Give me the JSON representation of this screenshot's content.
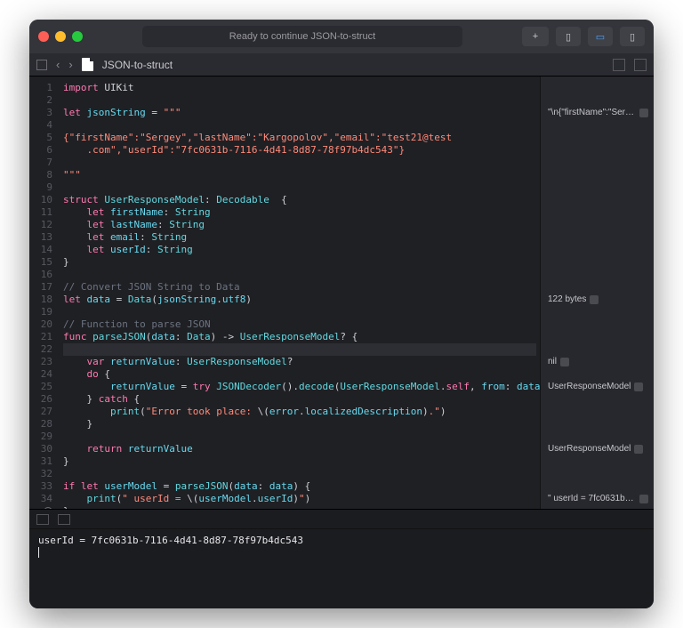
{
  "titlebar": {
    "status": "Ready to continue JSON-to-struct"
  },
  "tabbar": {
    "filename": "JSON-to-struct"
  },
  "code": {
    "lines": [
      {
        "n": 1,
        "segs": [
          {
            "c": "kw",
            "t": "import"
          },
          {
            "c": "",
            "t": " UIKit"
          }
        ]
      },
      {
        "n": 2,
        "segs": []
      },
      {
        "n": 3,
        "segs": [
          {
            "c": "kw",
            "t": "let"
          },
          {
            "c": "",
            "t": " "
          },
          {
            "c": "prop",
            "t": "jsonString"
          },
          {
            "c": "",
            "t": " = "
          },
          {
            "c": "str",
            "t": "\"\"\""
          }
        ]
      },
      {
        "n": 4,
        "segs": []
      },
      {
        "n": 5,
        "segs": [
          {
            "c": "str",
            "t": "{\"firstName\":\"Sergey\",\"lastName\":\"Kargopolov\",\"email\":\"test21@test"
          }
        ]
      },
      {
        "n": "",
        "segs": [
          {
            "c": "str",
            "t": "    .com\",\"userId\":\"7fc0631b-7116-4d41-8d87-78f97b4dc543\"}"
          }
        ]
      },
      {
        "n": 6,
        "segs": []
      },
      {
        "n": 7,
        "segs": [
          {
            "c": "str",
            "t": "\"\"\""
          }
        ]
      },
      {
        "n": 8,
        "segs": []
      },
      {
        "n": 9,
        "segs": [
          {
            "c": "kw",
            "t": "struct"
          },
          {
            "c": "",
            "t": " "
          },
          {
            "c": "ty",
            "t": "UserResponseModel"
          },
          {
            "c": "",
            "t": ": "
          },
          {
            "c": "ty",
            "t": "Decodable"
          },
          {
            "c": "",
            "t": "  {"
          }
        ]
      },
      {
        "n": 10,
        "segs": [
          {
            "c": "",
            "t": "    "
          },
          {
            "c": "kw",
            "t": "let"
          },
          {
            "c": "",
            "t": " "
          },
          {
            "c": "prop",
            "t": "firstName"
          },
          {
            "c": "",
            "t": ": "
          },
          {
            "c": "ty",
            "t": "String"
          }
        ]
      },
      {
        "n": 11,
        "segs": [
          {
            "c": "",
            "t": "    "
          },
          {
            "c": "kw",
            "t": "let"
          },
          {
            "c": "",
            "t": " "
          },
          {
            "c": "prop",
            "t": "lastName"
          },
          {
            "c": "",
            "t": ": "
          },
          {
            "c": "ty",
            "t": "String"
          }
        ]
      },
      {
        "n": 12,
        "segs": [
          {
            "c": "",
            "t": "    "
          },
          {
            "c": "kw",
            "t": "let"
          },
          {
            "c": "",
            "t": " "
          },
          {
            "c": "prop",
            "t": "email"
          },
          {
            "c": "",
            "t": ": "
          },
          {
            "c": "ty",
            "t": "String"
          }
        ]
      },
      {
        "n": 13,
        "segs": [
          {
            "c": "",
            "t": "    "
          },
          {
            "c": "kw",
            "t": "let"
          },
          {
            "c": "",
            "t": " "
          },
          {
            "c": "prop",
            "t": "userId"
          },
          {
            "c": "",
            "t": ": "
          },
          {
            "c": "ty",
            "t": "String"
          }
        ]
      },
      {
        "n": 14,
        "segs": [
          {
            "c": "",
            "t": "}"
          }
        ]
      },
      {
        "n": 15,
        "segs": []
      },
      {
        "n": 16,
        "segs": [
          {
            "c": "cm",
            "t": "// Convert JSON String to Data"
          }
        ]
      },
      {
        "n": 17,
        "segs": [
          {
            "c": "kw",
            "t": "let"
          },
          {
            "c": "",
            "t": " "
          },
          {
            "c": "prop",
            "t": "data"
          },
          {
            "c": "",
            "t": " = "
          },
          {
            "c": "ty",
            "t": "Data"
          },
          {
            "c": "",
            "t": "("
          },
          {
            "c": "prop",
            "t": "jsonString"
          },
          {
            "c": "",
            "t": "."
          },
          {
            "c": "prop",
            "t": "utf8"
          },
          {
            "c": "",
            "t": ")"
          }
        ]
      },
      {
        "n": 18,
        "segs": []
      },
      {
        "n": 19,
        "segs": [
          {
            "c": "cm",
            "t": "// Function to parse JSON"
          }
        ]
      },
      {
        "n": 20,
        "segs": [
          {
            "c": "kw",
            "t": "func"
          },
          {
            "c": "",
            "t": " "
          },
          {
            "c": "fn",
            "t": "parseJSON"
          },
          {
            "c": "",
            "t": "("
          },
          {
            "c": "prop",
            "t": "data"
          },
          {
            "c": "",
            "t": ": "
          },
          {
            "c": "ty",
            "t": "Data"
          },
          {
            "c": "",
            "t": ") -> "
          },
          {
            "c": "ty",
            "t": "UserResponseModel"
          },
          {
            "c": "",
            "t": "? {"
          }
        ]
      },
      {
        "n": 21,
        "segs": [],
        "hl": true
      },
      {
        "n": 22,
        "segs": [
          {
            "c": "",
            "t": "    "
          },
          {
            "c": "kw",
            "t": "var"
          },
          {
            "c": "",
            "t": " "
          },
          {
            "c": "prop",
            "t": "returnValue"
          },
          {
            "c": "",
            "t": ": "
          },
          {
            "c": "ty",
            "t": "UserResponseModel"
          },
          {
            "c": "",
            "t": "?"
          }
        ]
      },
      {
        "n": 23,
        "segs": [
          {
            "c": "",
            "t": "    "
          },
          {
            "c": "kw",
            "t": "do"
          },
          {
            "c": "",
            "t": " {"
          }
        ]
      },
      {
        "n": 24,
        "segs": [
          {
            "c": "",
            "t": "        "
          },
          {
            "c": "prop",
            "t": "returnValue"
          },
          {
            "c": "",
            "t": " = "
          },
          {
            "c": "kw",
            "t": "try"
          },
          {
            "c": "",
            "t": " "
          },
          {
            "c": "ty",
            "t": "JSONDecoder"
          },
          {
            "c": "",
            "t": "()."
          },
          {
            "c": "fn",
            "t": "decode"
          },
          {
            "c": "",
            "t": "("
          },
          {
            "c": "ty",
            "t": "UserResponseModel"
          },
          {
            "c": "",
            "t": "."
          },
          {
            "c": "kw",
            "t": "self"
          },
          {
            "c": "",
            "t": ", "
          },
          {
            "c": "prop",
            "t": "from"
          },
          {
            "c": "",
            "t": ": "
          },
          {
            "c": "prop",
            "t": "data"
          },
          {
            "c": "",
            "t": ")"
          }
        ]
      },
      {
        "n": 25,
        "segs": [
          {
            "c": "",
            "t": "    } "
          },
          {
            "c": "kw",
            "t": "catch"
          },
          {
            "c": "",
            "t": " {"
          }
        ]
      },
      {
        "n": 26,
        "segs": [
          {
            "c": "",
            "t": "        "
          },
          {
            "c": "fn",
            "t": "print"
          },
          {
            "c": "",
            "t": "("
          },
          {
            "c": "str",
            "t": "\"Error took place: "
          },
          {
            "c": "",
            "t": "\\("
          },
          {
            "c": "prop",
            "t": "error"
          },
          {
            "c": "",
            "t": "."
          },
          {
            "c": "prop",
            "t": "localizedDescription"
          },
          {
            "c": "",
            "t": ")"
          },
          {
            "c": "str",
            "t": ".\""
          },
          {
            "c": "",
            "t": ")"
          }
        ]
      },
      {
        "n": 27,
        "segs": [
          {
            "c": "",
            "t": "    }"
          }
        ]
      },
      {
        "n": 28,
        "segs": []
      },
      {
        "n": 29,
        "segs": [
          {
            "c": "",
            "t": "    "
          },
          {
            "c": "kw",
            "t": "return"
          },
          {
            "c": "",
            "t": " "
          },
          {
            "c": "prop",
            "t": "returnValue"
          }
        ]
      },
      {
        "n": 30,
        "segs": [
          {
            "c": "",
            "t": "}"
          }
        ]
      },
      {
        "n": 31,
        "segs": []
      },
      {
        "n": 32,
        "segs": [
          {
            "c": "kw",
            "t": "if"
          },
          {
            "c": "",
            "t": " "
          },
          {
            "c": "kw",
            "t": "let"
          },
          {
            "c": "",
            "t": " "
          },
          {
            "c": "prop",
            "t": "userModel"
          },
          {
            "c": "",
            "t": " = "
          },
          {
            "c": "fn",
            "t": "parseJSON"
          },
          {
            "c": "",
            "t": "("
          },
          {
            "c": "prop",
            "t": "data"
          },
          {
            "c": "",
            "t": ": "
          },
          {
            "c": "prop",
            "t": "data"
          },
          {
            "c": "",
            "t": ") {"
          }
        ]
      },
      {
        "n": 33,
        "segs": [
          {
            "c": "",
            "t": "    "
          },
          {
            "c": "fn",
            "t": "print"
          },
          {
            "c": "",
            "t": "("
          },
          {
            "c": "str",
            "t": "\" userId = "
          },
          {
            "c": "",
            "t": "\\("
          },
          {
            "c": "prop",
            "t": "userModel"
          },
          {
            "c": "",
            "t": "."
          },
          {
            "c": "prop",
            "t": "userId"
          },
          {
            "c": "",
            "t": ")"
          },
          {
            "c": "str",
            "t": "\""
          },
          {
            "c": "",
            "t": ")"
          }
        ]
      },
      {
        "n": 34,
        "segs": [
          {
            "c": "",
            "t": "}"
          }
        ]
      }
    ],
    "afterRun": "36"
  },
  "side": [
    {
      "at": 3,
      "text": "\"\\n{\"firstName\":\"Serg…",
      "box": true
    },
    {
      "at": 17,
      "text": "122 bytes",
      "box": true
    },
    {
      "at": 22,
      "text": "nil",
      "box": true
    },
    {
      "at": 24,
      "text": "UserResponseModel",
      "box": true
    },
    {
      "at": 29,
      "text": "UserResponseModel",
      "box": true
    },
    {
      "at": 33,
      "text": "\" userId = 7fc0631b-…",
      "box": true
    }
  ],
  "console": {
    "output": "userId = 7fc0631b-7116-4d41-8d87-78f97b4dc543"
  }
}
